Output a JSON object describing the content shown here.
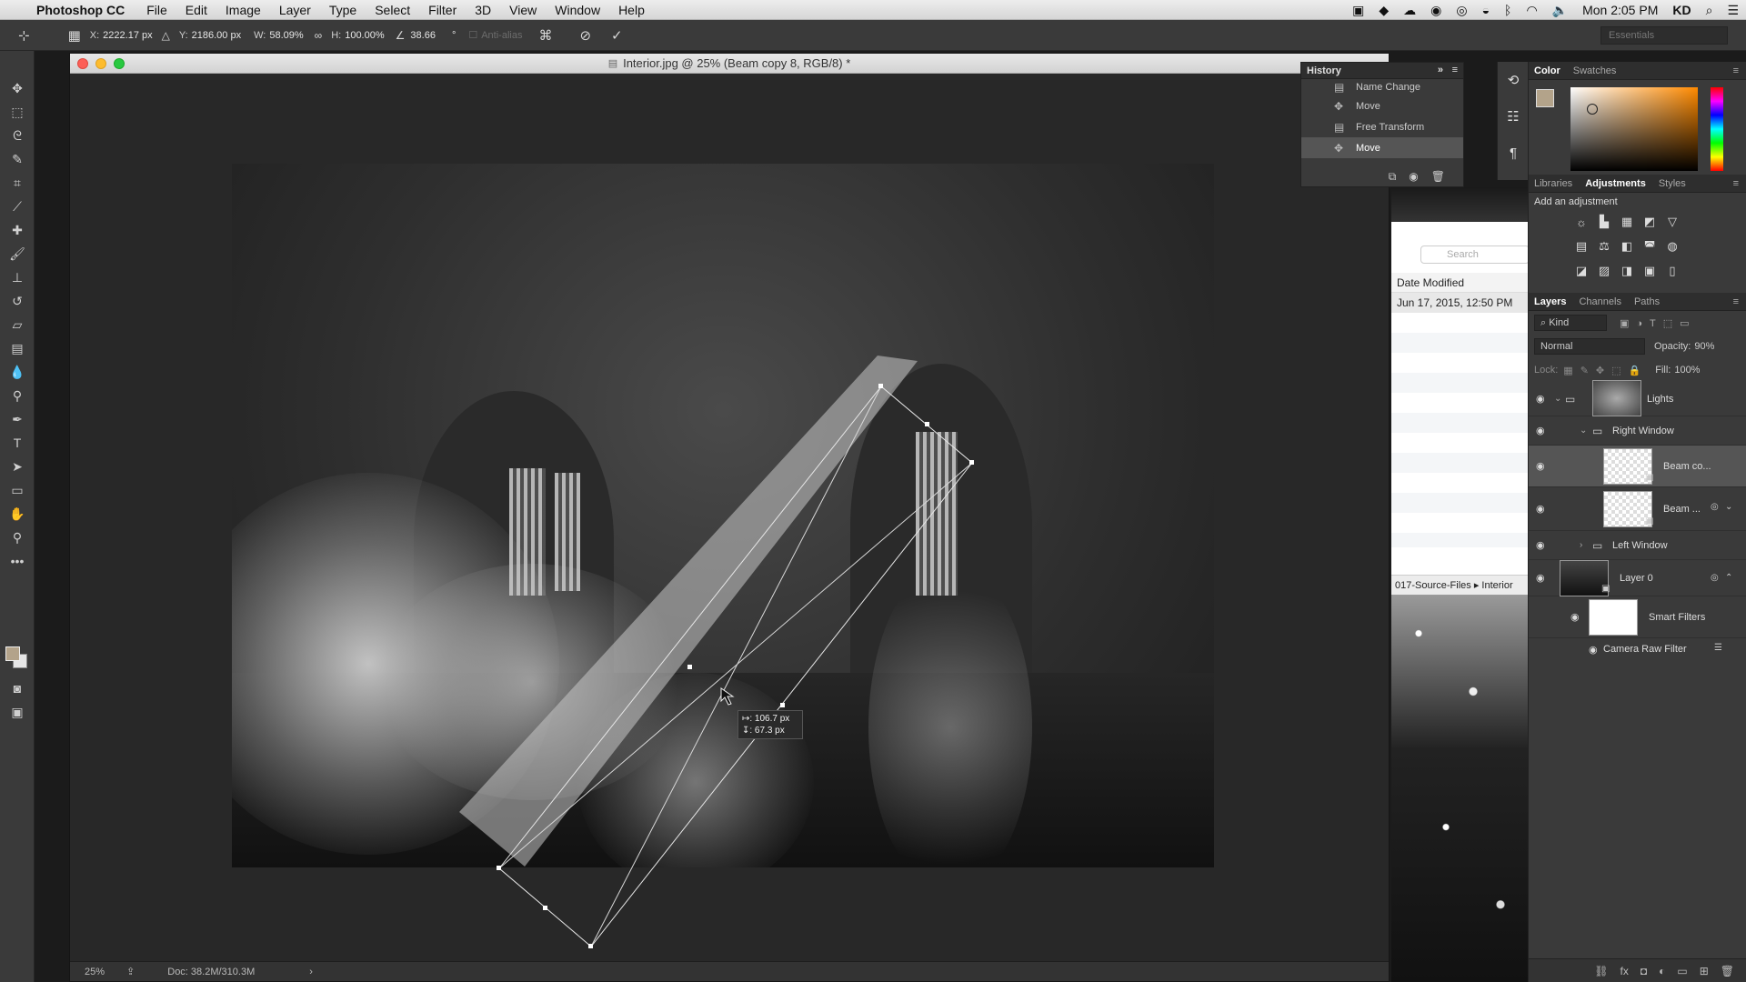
{
  "menubar": {
    "app_name": "Photoshop CC",
    "menus": [
      "File",
      "Edit",
      "Image",
      "Layer",
      "Type",
      "Select",
      "Filter",
      "3D",
      "View",
      "Window",
      "Help"
    ],
    "clock": "Mon 2:05 PM",
    "user": "KD"
  },
  "options": {
    "x_label": "X:",
    "x_value": "2222.17 px",
    "y_label": "Y:",
    "y_value": "2186.00 px",
    "w_label": "W:",
    "w_value": "58.09%",
    "h_label": "H:",
    "h_value": "100.00%",
    "angle_value": "38.66",
    "angle_unit": "°",
    "antialias_label": "Anti-alias",
    "workspace": "Essentials"
  },
  "document": {
    "title": "Interior.jpg @ 25% (Beam copy 8, RGB/8) *",
    "zoom": "25%",
    "doc_size": "Doc: 38.2M/310.3M",
    "tooltip_line1": "↦: 106.7 px",
    "tooltip_line2": "↧:  67.3 px"
  },
  "history": {
    "title": "History",
    "items": [
      "Name Change",
      "Move",
      "Free Transform",
      "Move"
    ],
    "selected_index": 3
  },
  "finder": {
    "search_placeholder": "Search",
    "header": "Date Modified",
    "date": "Jun 17, 2015, 12:50 PM",
    "path_1": "017-Source-Files",
    "path_2": "Interior"
  },
  "panels": {
    "color_tabs": [
      "Color",
      "Swatches"
    ],
    "adj_tabs": [
      "Libraries",
      "Adjustments",
      "Styles"
    ],
    "adj_title": "Add an adjustment",
    "layer_tabs": [
      "Layers",
      "Channels",
      "Paths"
    ],
    "kind_placeholder": "Kind",
    "blend_mode": "Normal",
    "opacity_label": "Opacity:",
    "opacity_value": "90%",
    "lock_label": "Lock:",
    "fill_label": "Fill:",
    "fill_value": "100%",
    "fg_color": "#b3a38a",
    "bg_color": "#e6e6e6"
  },
  "layers": [
    {
      "name": "Lights"
    },
    {
      "name": "Right Window"
    },
    {
      "name": "Beam co..."
    },
    {
      "name": "Beam ..."
    },
    {
      "name": "Left Window"
    },
    {
      "name": "Layer 0"
    },
    {
      "name": "Smart Filters"
    },
    {
      "name": "Camera Raw Filter"
    }
  ]
}
